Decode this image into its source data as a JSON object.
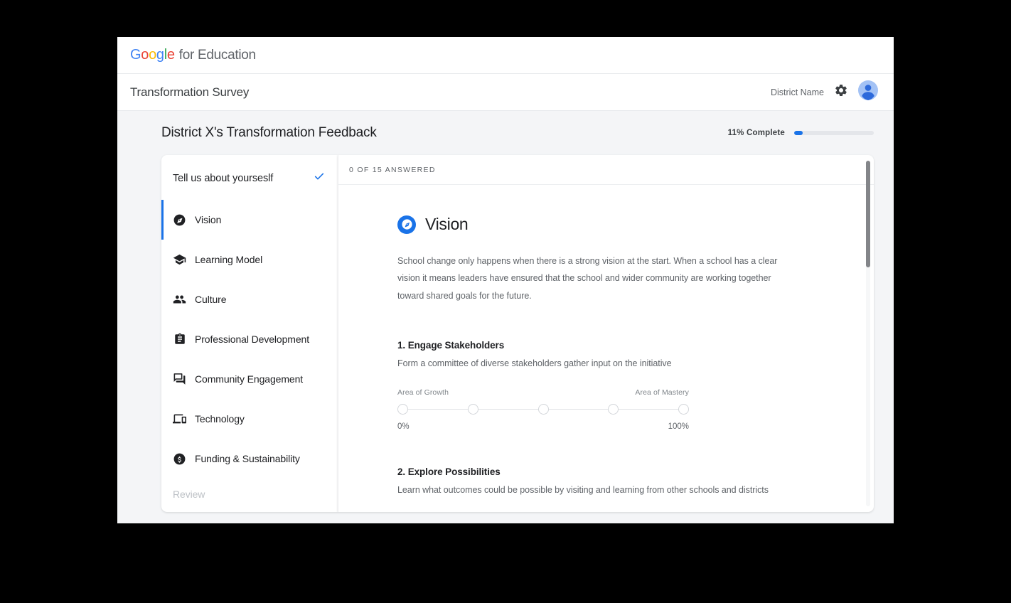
{
  "brand": {
    "logo_letters": [
      "G",
      "o",
      "o",
      "g",
      "l",
      "e"
    ],
    "suffix": "for Education"
  },
  "app_bar": {
    "title": "Transformation Survey",
    "district_name": "District Name",
    "gear_icon": "gear-icon",
    "avatar_icon": "avatar-icon"
  },
  "page_header": {
    "title": "District X's Transformation Feedback",
    "progress_percent_text": "11%",
    "progress_complete_text": "Complete",
    "progress_value": 11,
    "accent_color": "#1a73e8"
  },
  "sidebar": {
    "intro": {
      "label": "Tell us about yourseslf",
      "check_icon": "check-icon",
      "completed": true
    },
    "items": [
      {
        "label": "Vision",
        "icon": "compass-icon",
        "active": true
      },
      {
        "label": "Learning Model",
        "icon": "graduation-cap-icon",
        "active": false
      },
      {
        "label": "Culture",
        "icon": "people-icon",
        "active": false
      },
      {
        "label": "Professional Development",
        "icon": "clipboard-icon",
        "active": false
      },
      {
        "label": "Community Engagement",
        "icon": "chat-bubbles-icon",
        "active": false
      },
      {
        "label": "Technology",
        "icon": "devices-icon",
        "active": false
      },
      {
        "label": "Funding & Sustainability",
        "icon": "dollar-circle-icon",
        "active": false
      }
    ],
    "review_label": "Review"
  },
  "content": {
    "answered_status": "0 OF 15 ANSWERED",
    "section": {
      "badge_icon": "compass-icon",
      "title": "Vision",
      "description": "School change only happens when there is a strong vision at the start. When a school has a clear vision it means leaders have ensured that the school and wider community are working together toward shared goals for the future."
    },
    "scale_labels": {
      "left": "Area of Growth",
      "right": "Area of Mastery",
      "left_pct": "0%",
      "right_pct": "100%"
    },
    "questions": [
      {
        "title": "1. Engage Stakeholders",
        "description": "Form a committee of diverse stakeholders gather input on the initiative",
        "selected": null,
        "options": 5
      },
      {
        "title": "2. Explore Possibilities",
        "description": "Learn what outcomes could be possible by visiting and learning from other schools and districts",
        "selected": null,
        "options": 5
      }
    ]
  }
}
